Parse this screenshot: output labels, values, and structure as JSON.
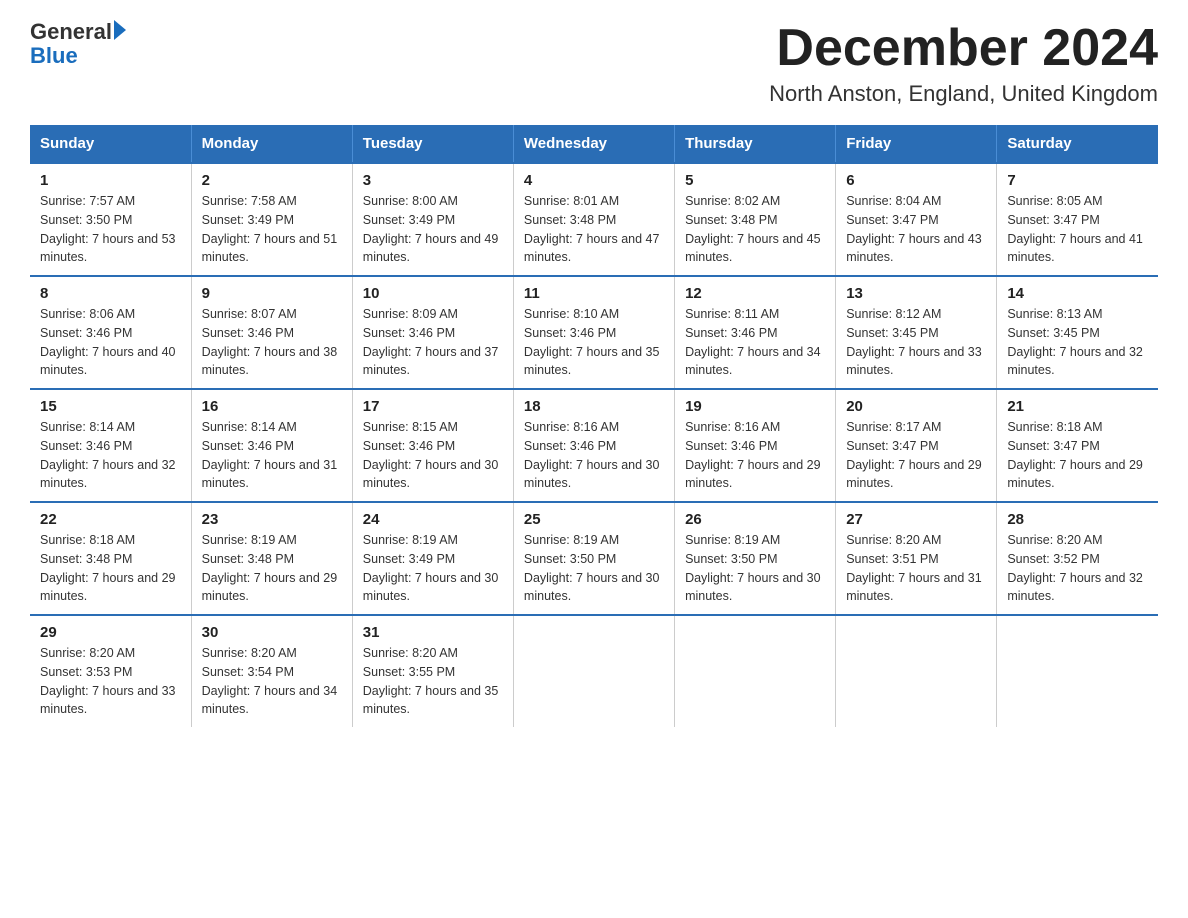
{
  "logo": {
    "text_general": "General",
    "text_blue": "Blue",
    "triangle": "▶"
  },
  "title": "December 2024",
  "subtitle": "North Anston, England, United Kingdom",
  "days_of_week": [
    "Sunday",
    "Monday",
    "Tuesday",
    "Wednesday",
    "Thursday",
    "Friday",
    "Saturday"
  ],
  "weeks": [
    [
      {
        "num": "1",
        "sunrise": "Sunrise: 7:57 AM",
        "sunset": "Sunset: 3:50 PM",
        "daylight": "Daylight: 7 hours and 53 minutes."
      },
      {
        "num": "2",
        "sunrise": "Sunrise: 7:58 AM",
        "sunset": "Sunset: 3:49 PM",
        "daylight": "Daylight: 7 hours and 51 minutes."
      },
      {
        "num": "3",
        "sunrise": "Sunrise: 8:00 AM",
        "sunset": "Sunset: 3:49 PM",
        "daylight": "Daylight: 7 hours and 49 minutes."
      },
      {
        "num": "4",
        "sunrise": "Sunrise: 8:01 AM",
        "sunset": "Sunset: 3:48 PM",
        "daylight": "Daylight: 7 hours and 47 minutes."
      },
      {
        "num": "5",
        "sunrise": "Sunrise: 8:02 AM",
        "sunset": "Sunset: 3:48 PM",
        "daylight": "Daylight: 7 hours and 45 minutes."
      },
      {
        "num": "6",
        "sunrise": "Sunrise: 8:04 AM",
        "sunset": "Sunset: 3:47 PM",
        "daylight": "Daylight: 7 hours and 43 minutes."
      },
      {
        "num": "7",
        "sunrise": "Sunrise: 8:05 AM",
        "sunset": "Sunset: 3:47 PM",
        "daylight": "Daylight: 7 hours and 41 minutes."
      }
    ],
    [
      {
        "num": "8",
        "sunrise": "Sunrise: 8:06 AM",
        "sunset": "Sunset: 3:46 PM",
        "daylight": "Daylight: 7 hours and 40 minutes."
      },
      {
        "num": "9",
        "sunrise": "Sunrise: 8:07 AM",
        "sunset": "Sunset: 3:46 PM",
        "daylight": "Daylight: 7 hours and 38 minutes."
      },
      {
        "num": "10",
        "sunrise": "Sunrise: 8:09 AM",
        "sunset": "Sunset: 3:46 PM",
        "daylight": "Daylight: 7 hours and 37 minutes."
      },
      {
        "num": "11",
        "sunrise": "Sunrise: 8:10 AM",
        "sunset": "Sunset: 3:46 PM",
        "daylight": "Daylight: 7 hours and 35 minutes."
      },
      {
        "num": "12",
        "sunrise": "Sunrise: 8:11 AM",
        "sunset": "Sunset: 3:46 PM",
        "daylight": "Daylight: 7 hours and 34 minutes."
      },
      {
        "num": "13",
        "sunrise": "Sunrise: 8:12 AM",
        "sunset": "Sunset: 3:45 PM",
        "daylight": "Daylight: 7 hours and 33 minutes."
      },
      {
        "num": "14",
        "sunrise": "Sunrise: 8:13 AM",
        "sunset": "Sunset: 3:45 PM",
        "daylight": "Daylight: 7 hours and 32 minutes."
      }
    ],
    [
      {
        "num": "15",
        "sunrise": "Sunrise: 8:14 AM",
        "sunset": "Sunset: 3:46 PM",
        "daylight": "Daylight: 7 hours and 32 minutes."
      },
      {
        "num": "16",
        "sunrise": "Sunrise: 8:14 AM",
        "sunset": "Sunset: 3:46 PM",
        "daylight": "Daylight: 7 hours and 31 minutes."
      },
      {
        "num": "17",
        "sunrise": "Sunrise: 8:15 AM",
        "sunset": "Sunset: 3:46 PM",
        "daylight": "Daylight: 7 hours and 30 minutes."
      },
      {
        "num": "18",
        "sunrise": "Sunrise: 8:16 AM",
        "sunset": "Sunset: 3:46 PM",
        "daylight": "Daylight: 7 hours and 30 minutes."
      },
      {
        "num": "19",
        "sunrise": "Sunrise: 8:16 AM",
        "sunset": "Sunset: 3:46 PM",
        "daylight": "Daylight: 7 hours and 29 minutes."
      },
      {
        "num": "20",
        "sunrise": "Sunrise: 8:17 AM",
        "sunset": "Sunset: 3:47 PM",
        "daylight": "Daylight: 7 hours and 29 minutes."
      },
      {
        "num": "21",
        "sunrise": "Sunrise: 8:18 AM",
        "sunset": "Sunset: 3:47 PM",
        "daylight": "Daylight: 7 hours and 29 minutes."
      }
    ],
    [
      {
        "num": "22",
        "sunrise": "Sunrise: 8:18 AM",
        "sunset": "Sunset: 3:48 PM",
        "daylight": "Daylight: 7 hours and 29 minutes."
      },
      {
        "num": "23",
        "sunrise": "Sunrise: 8:19 AM",
        "sunset": "Sunset: 3:48 PM",
        "daylight": "Daylight: 7 hours and 29 minutes."
      },
      {
        "num": "24",
        "sunrise": "Sunrise: 8:19 AM",
        "sunset": "Sunset: 3:49 PM",
        "daylight": "Daylight: 7 hours and 30 minutes."
      },
      {
        "num": "25",
        "sunrise": "Sunrise: 8:19 AM",
        "sunset": "Sunset: 3:50 PM",
        "daylight": "Daylight: 7 hours and 30 minutes."
      },
      {
        "num": "26",
        "sunrise": "Sunrise: 8:19 AM",
        "sunset": "Sunset: 3:50 PM",
        "daylight": "Daylight: 7 hours and 30 minutes."
      },
      {
        "num": "27",
        "sunrise": "Sunrise: 8:20 AM",
        "sunset": "Sunset: 3:51 PM",
        "daylight": "Daylight: 7 hours and 31 minutes."
      },
      {
        "num": "28",
        "sunrise": "Sunrise: 8:20 AM",
        "sunset": "Sunset: 3:52 PM",
        "daylight": "Daylight: 7 hours and 32 minutes."
      }
    ],
    [
      {
        "num": "29",
        "sunrise": "Sunrise: 8:20 AM",
        "sunset": "Sunset: 3:53 PM",
        "daylight": "Daylight: 7 hours and 33 minutes."
      },
      {
        "num": "30",
        "sunrise": "Sunrise: 8:20 AM",
        "sunset": "Sunset: 3:54 PM",
        "daylight": "Daylight: 7 hours and 34 minutes."
      },
      {
        "num": "31",
        "sunrise": "Sunrise: 8:20 AM",
        "sunset": "Sunset: 3:55 PM",
        "daylight": "Daylight: 7 hours and 35 minutes."
      },
      null,
      null,
      null,
      null
    ]
  ]
}
